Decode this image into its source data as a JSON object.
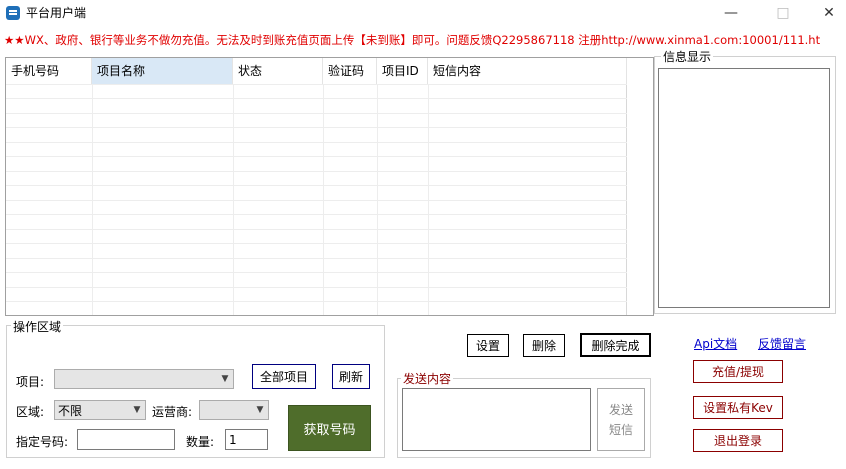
{
  "window": {
    "title": "平台用户端"
  },
  "notice": "★★WX、政府、银行等业务不做勿充值。无法及时到账充值页面上传【未到账】即可。问题反馈Q2295867118 注册http://www.xinma1.com:10001/111.ht",
  "table": {
    "columns": [
      "手机号码",
      "项目名称",
      "状态",
      "验证码",
      "项目ID",
      "短信内容"
    ],
    "rows": []
  },
  "info": {
    "label": "信息显示"
  },
  "operation": {
    "label": "操作区域",
    "project_label": "项目:",
    "project_value": "",
    "all_projects_button": "全部项目",
    "refresh_button": "刷新",
    "region_label": "区域:",
    "region_value": "不限",
    "carrier_label": "运营商:",
    "carrier_value": "",
    "number_label": "指定号码:",
    "number_value": "",
    "quantity_label": "数量:",
    "quantity_value": "1",
    "get_number_button": "获取号码"
  },
  "actions": {
    "settings_button": "设置",
    "delete_button": "删除",
    "delete_done_button": "删除完成"
  },
  "send": {
    "label": "发送内容",
    "content": "",
    "send_button_line1": "发送",
    "send_button_line2": "短信"
  },
  "links": {
    "api_docs": "Api文档",
    "feedback": "反馈留言"
  },
  "side_buttons": {
    "recharge": "充值/提现",
    "private_key": "设置私有Kev",
    "logout": "退出登录"
  },
  "colors": {
    "notice": "#e00000",
    "accent_blue": "#1f6fb8",
    "get_number_bg": "#4f6d2b",
    "dark_red": "#8b0000"
  }
}
